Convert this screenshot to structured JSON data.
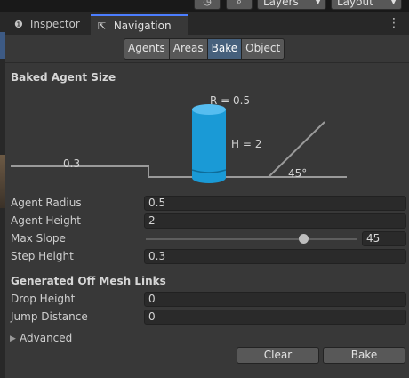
{
  "toolbar": {
    "history_icon": "history-icon",
    "search_icon": "search-icon",
    "layers_label": "Layers",
    "layout_label": "Layout"
  },
  "tabs": [
    {
      "label": "Inspector",
      "icon": "info-icon",
      "active": false
    },
    {
      "label": "Navigation",
      "icon": "navigation-icon",
      "active": true
    }
  ],
  "subtabs": [
    {
      "label": "Agents",
      "active": false
    },
    {
      "label": "Areas",
      "active": false
    },
    {
      "label": "Bake",
      "active": true
    },
    {
      "label": "Object",
      "active": false
    }
  ],
  "baked_agent": {
    "title": "Baked Agent Size",
    "diagram": {
      "radius_label": "R = 0.5",
      "height_label": "H = 2",
      "step_label": "0.3",
      "slope_label": "45°"
    },
    "fields": {
      "agent_radius_label": "Agent Radius",
      "agent_radius_value": "0.5",
      "agent_height_label": "Agent Height",
      "agent_height_value": "2",
      "max_slope_label": "Max Slope",
      "max_slope_value": "45",
      "max_slope_fraction": 0.75,
      "step_height_label": "Step Height",
      "step_height_value": "0.3"
    }
  },
  "off_mesh": {
    "title": "Generated Off Mesh Links",
    "drop_height_label": "Drop Height",
    "drop_height_value": "0",
    "jump_distance_label": "Jump Distance",
    "jump_distance_value": "0"
  },
  "advanced": {
    "label": "Advanced",
    "expanded": false
  },
  "actions": {
    "clear_label": "Clear",
    "bake_label": "Bake"
  },
  "colors": {
    "accent": "#4c7eff",
    "cylinder": "#1a9ad6",
    "active_tab": "#46607c"
  }
}
